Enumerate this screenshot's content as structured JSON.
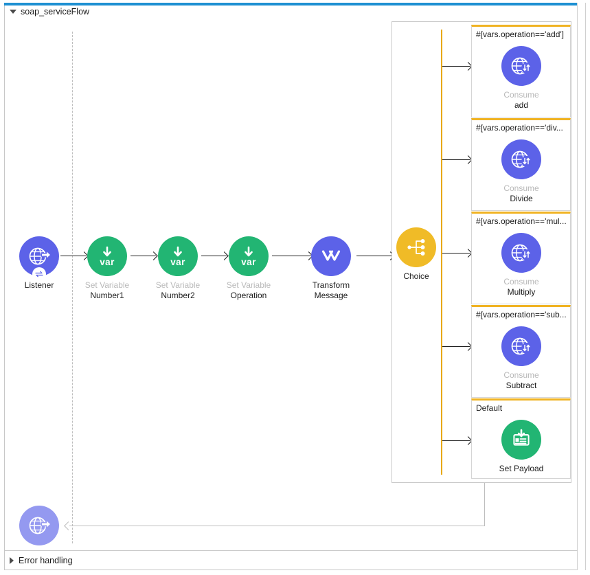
{
  "flow": {
    "name": "soap_serviceFlow",
    "collapse_icon": "triangle-down-icon",
    "accent_color": "#1e90d2"
  },
  "error_handling": {
    "label": "Error handling",
    "expand_icon": "triangle-right-icon"
  },
  "palette": {
    "purple": "#5c62e8",
    "purple_light": "#9499f0",
    "green": "#22b573",
    "yellow": "#f0bb27",
    "branch_top": "#f0b323",
    "spine": "#e8a917",
    "connector": "#1b1b1b",
    "sub_text": "#b9b9b9"
  },
  "main_flow": {
    "nodes": [
      {
        "id": "listener",
        "icon": "globe-arrow-right-icon",
        "badge_icon": "exchange-icon",
        "sub": "",
        "label": "Listener",
        "color": "#5c62e8"
      },
      {
        "id": "set-variable-number1",
        "icon": "var-down-arrow-icon",
        "sub": "Set Variable",
        "label": "Number1",
        "color": "#22b573"
      },
      {
        "id": "set-variable-number2",
        "icon": "var-down-arrow-icon",
        "sub": "Set Variable",
        "label": "Number2",
        "color": "#22b573"
      },
      {
        "id": "set-variable-operation",
        "icon": "var-down-arrow-icon",
        "sub": "Set Variable",
        "label": "Operation",
        "color": "#22b573"
      },
      {
        "id": "transform-message",
        "icon": "transform-chevrons-icon",
        "sub": "Transform",
        "label": "Message",
        "color": "#5c62e8"
      },
      {
        "id": "choice",
        "icon": "choice-branch-icon",
        "sub": "",
        "label": "Choice",
        "color": "#f0bb27"
      }
    ]
  },
  "choice_branches": [
    {
      "id": "branch-add",
      "condition": "#[vars.operation=='add']",
      "icon": "globe-exchange-icon",
      "sub": "Consume",
      "label": "add",
      "color": "#5c62e8"
    },
    {
      "id": "branch-divide",
      "condition": "#[vars.operation=='div...",
      "icon": "globe-exchange-icon",
      "sub": "Consume",
      "label": "Divide",
      "color": "#5c62e8"
    },
    {
      "id": "branch-multiply",
      "condition": "#[vars.operation=='mul...",
      "icon": "globe-exchange-icon",
      "sub": "Consume",
      "label": "Multiply",
      "color": "#5c62e8"
    },
    {
      "id": "branch-subtract",
      "condition": "#[vars.operation=='sub...",
      "icon": "globe-exchange-icon",
      "sub": "Consume",
      "label": "Subtract",
      "color": "#5c62e8"
    },
    {
      "id": "branch-default",
      "condition": "Default",
      "icon": "set-payload-icon",
      "sub": "",
      "label": "Set Payload",
      "color": "#22b573"
    }
  ],
  "error_node": {
    "id": "error-listener",
    "icon": "globe-arrow-right-icon",
    "color": "#9499f0"
  }
}
